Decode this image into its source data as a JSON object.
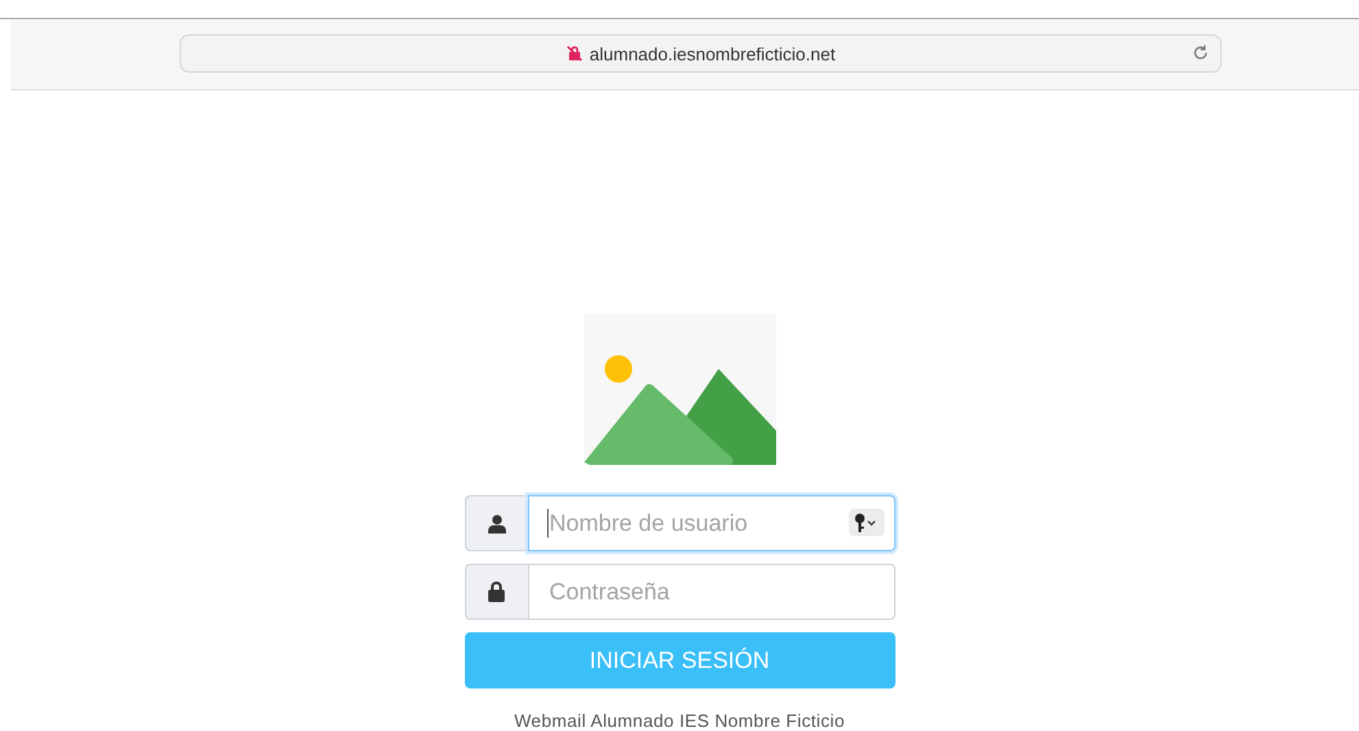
{
  "browser": {
    "url": "alumnado.iesnombreficticio.net"
  },
  "login": {
    "fields": [
      {
        "kind": "user",
        "placeholder": "Nombre de usuario",
        "focused": true,
        "keychain": true
      },
      {
        "kind": "password",
        "placeholder": "Contraseña",
        "focused": false,
        "keychain": false
      }
    ],
    "button": "INICIAR SESIÓN",
    "footer": "Webmail Alumnado IES Nombre Ficticio"
  }
}
